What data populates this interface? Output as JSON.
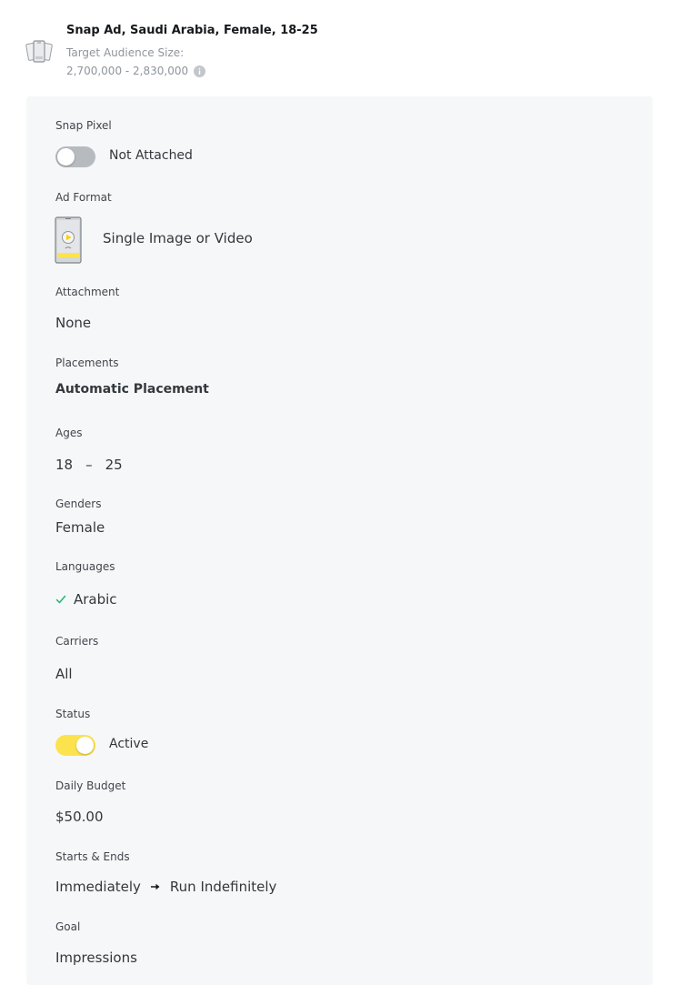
{
  "header": {
    "title": "Snap Ad, Saudi Arabia, Female, 18-25",
    "audience_label": "Target Audience Size:",
    "audience_size": "2,700,000 - 2,830,000",
    "icon": "phones-stack-icon"
  },
  "details": {
    "snap_pixel": {
      "label": "Snap Pixel",
      "toggle_on": false,
      "value": "Not Attached"
    },
    "ad_format": {
      "label": "Ad Format",
      "value": "Single Image or Video",
      "icon": "phone-play-icon"
    },
    "attachment": {
      "label": "Attachment",
      "value": "None"
    },
    "placements": {
      "label": "Placements",
      "value": "Automatic Placement"
    },
    "ages": {
      "label": "Ages",
      "min": "18",
      "separator": "–",
      "max": "25"
    },
    "genders": {
      "label": "Genders",
      "value": "Female"
    },
    "languages": {
      "label": "Languages",
      "items": [
        "Arabic"
      ]
    },
    "carriers": {
      "label": "Carriers",
      "value": "All"
    },
    "status": {
      "label": "Status",
      "toggle_on": true,
      "value": "Active"
    },
    "daily_budget": {
      "label": "Daily Budget",
      "value": "$50.00"
    },
    "schedule": {
      "label": "Starts & Ends",
      "start": "Immediately",
      "end": "Run Indefinitely"
    },
    "goal": {
      "label": "Goal",
      "value": "Impressions"
    }
  },
  "colors": {
    "toggle_on": "#fce34d",
    "toggle_off": "#b7bbc0",
    "check": "#21b573",
    "panel_bg": "#f6f7f8"
  }
}
